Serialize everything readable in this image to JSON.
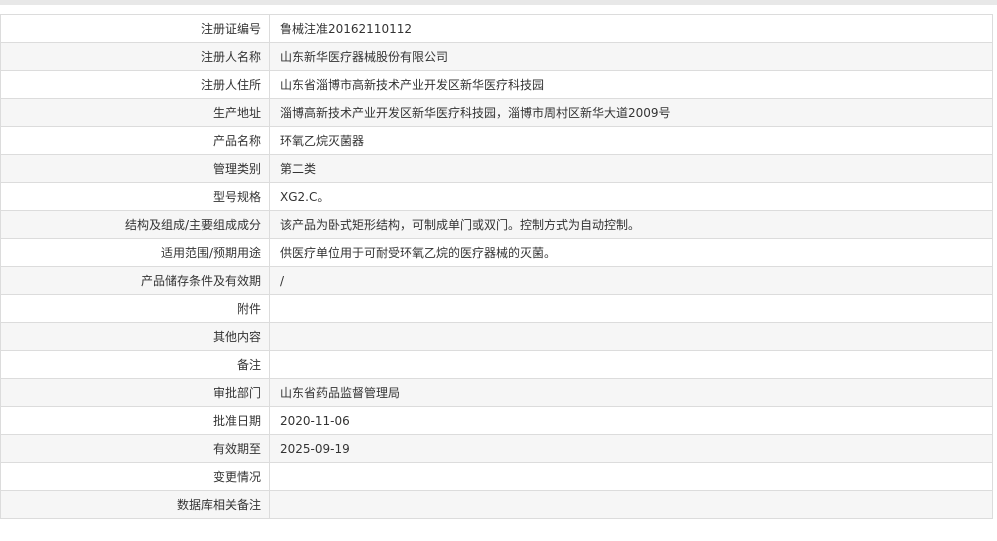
{
  "rows": [
    {
      "label": "注册证编号",
      "value": "鲁械注准20162110112"
    },
    {
      "label": "注册人名称",
      "value": "山东新华医疗器械股份有限公司"
    },
    {
      "label": "注册人住所",
      "value": "山东省淄博市高新技术产业开发区新华医疗科技园"
    },
    {
      "label": "生产地址",
      "value": "淄博高新技术产业开发区新华医疗科技园，淄博市周村区新华大道2009号"
    },
    {
      "label": "产品名称",
      "value": "环氧乙烷灭菌器"
    },
    {
      "label": "管理类别",
      "value": "第二类"
    },
    {
      "label": "型号规格",
      "value": "XG2.C。"
    },
    {
      "label": "结构及组成/主要组成成分",
      "value": "该产品为卧式矩形结构，可制成单门或双门。控制方式为自动控制。"
    },
    {
      "label": "适用范围/预期用途",
      "value": "供医疗单位用于可耐受环氧乙烷的医疗器械的灭菌。"
    },
    {
      "label": "产品储存条件及有效期",
      "value": "/"
    },
    {
      "label": "附件",
      "value": ""
    },
    {
      "label": "其他内容",
      "value": ""
    },
    {
      "label": "备注",
      "value": ""
    },
    {
      "label": "审批部门",
      "value": "山东省药品监督管理局"
    },
    {
      "label": "批准日期",
      "value": "2020-11-06"
    },
    {
      "label": "有效期至",
      "value": "2025-09-19"
    },
    {
      "label": "变更情况",
      "value": ""
    },
    {
      "label": "数据库相关备注",
      "value": ""
    }
  ]
}
